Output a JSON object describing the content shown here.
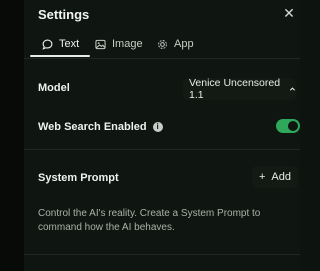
{
  "panel": {
    "title": "Settings",
    "close_icon": "close-icon"
  },
  "tabs": [
    {
      "label": "Text",
      "icon": "chat-bubble-icon",
      "active": true
    },
    {
      "label": "Image",
      "icon": "image-icon",
      "active": false
    },
    {
      "label": "App",
      "icon": "gear-icon",
      "active": false
    }
  ],
  "model": {
    "label": "Model",
    "selected": "Venice Uncensored 1.1",
    "icon": "chevron-up-icon"
  },
  "web_search": {
    "label": "Web Search Enabled",
    "info_glyph": "i",
    "enabled": true
  },
  "system_prompt": {
    "label": "System Prompt",
    "add_label": "Add",
    "add_glyph": "+",
    "description": "Control the AI's reality. Create a System Prompt to command how the AI behaves."
  },
  "colors": {
    "background": "#0f1510",
    "toggle_on": "#2ea85a",
    "text": "#eef2ee",
    "muted_text": "#a9b1a9"
  }
}
